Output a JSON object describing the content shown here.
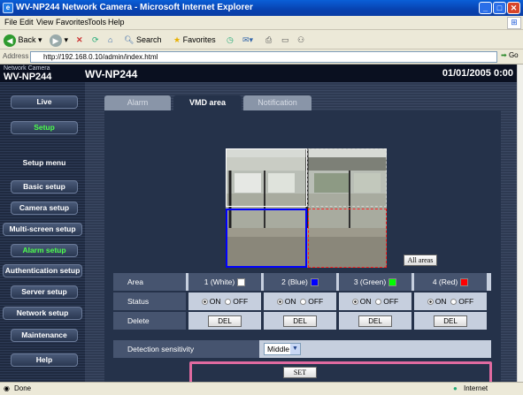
{
  "window": {
    "title": "WV-NP244 Network Camera - Microsoft Internet Explorer"
  },
  "menu": [
    "File",
    "Edit",
    "View",
    "Favorites",
    "Tools",
    "Help"
  ],
  "toolbar": {
    "back": "Back",
    "search": "Search",
    "favorites": "Favorites"
  },
  "address": {
    "label": "Address",
    "url": "http://192.168.0.10/admin/index.html",
    "go": "Go"
  },
  "header": {
    "small": "Network Camera",
    "model": "WV-NP244",
    "title": "WV-NP244",
    "date": "01/01/2005 0:00"
  },
  "sidebar": {
    "live": "Live",
    "setup": "Setup",
    "setup_menu": "Setup menu",
    "basic": "Basic setup",
    "camera": "Camera setup",
    "multi": "Multi-screen setup",
    "alarm": "Alarm setup",
    "auth": "Authentication setup",
    "server": "Server setup",
    "network": "Network setup",
    "maintenance": "Maintenance",
    "help": "Help"
  },
  "tabs": [
    "Alarm",
    "VMD area",
    "Notification"
  ],
  "all_areas": "All areas",
  "table": {
    "area_label": "Area",
    "status_label": "Status",
    "delete_label": "Delete",
    "areas": [
      {
        "name": "1 (White)",
        "color": "#ffffff"
      },
      {
        "name": "2 (Blue)",
        "color": "#0000ff"
      },
      {
        "name": "3 (Green)",
        "color": "#00ff00"
      },
      {
        "name": "4 (Red)",
        "color": "#ff0000"
      }
    ],
    "on": "ON",
    "off": "OFF",
    "del": "DEL"
  },
  "sensitivity": {
    "label": "Detection sensitivity",
    "value": "Middle"
  },
  "set": "SET",
  "status": {
    "left": "Done",
    "right": "Internet"
  }
}
